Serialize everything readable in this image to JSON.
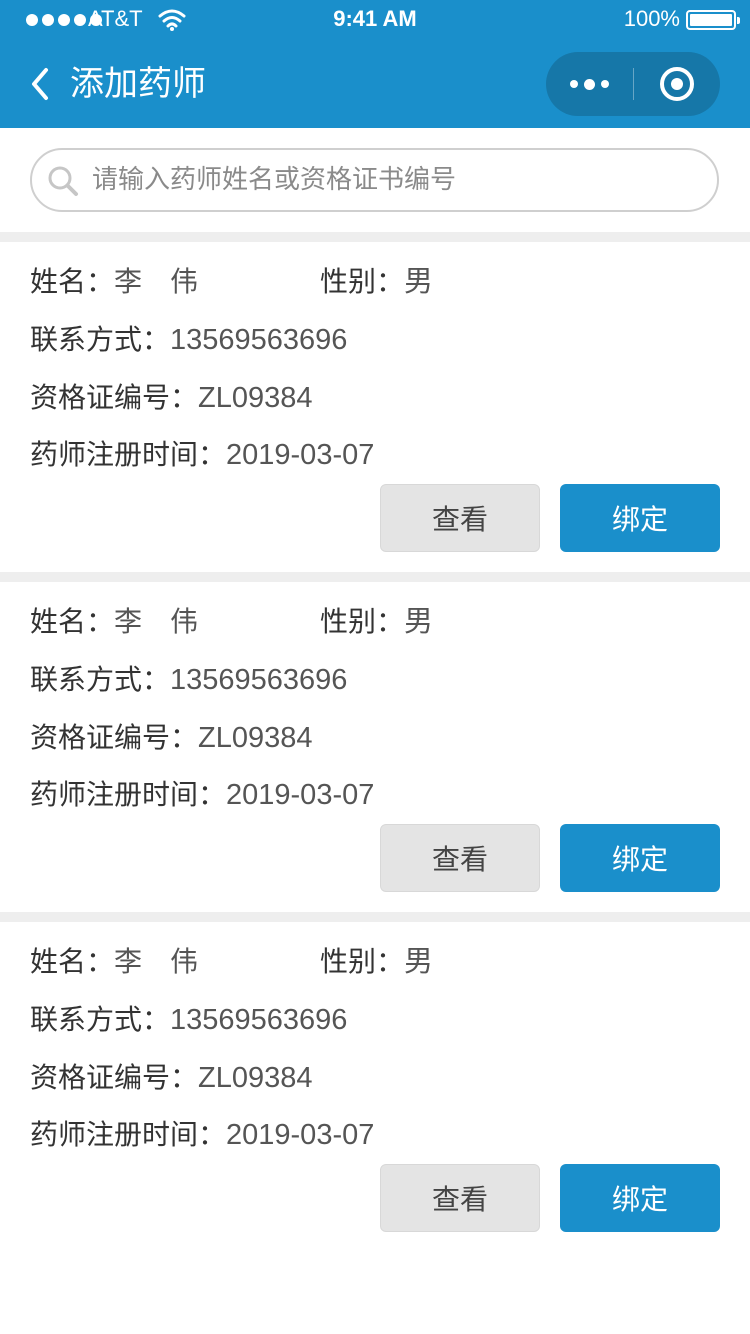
{
  "status_bar": {
    "carrier": "AT&T",
    "time": "9:41 AM",
    "battery": "100%"
  },
  "nav": {
    "title": "添加药师"
  },
  "search": {
    "placeholder": "请输入药师姓名或资格证书编号"
  },
  "labels": {
    "name": "姓名：",
    "gender": "性别：",
    "contact": "联系方式：",
    "cert_no": "资格证编号：",
    "reg_time": "药师注册时间：",
    "view_button": "查看",
    "bind_button": "绑定"
  },
  "pharmacists": [
    {
      "name": "李伟",
      "gender": "男",
      "contact": "13569563696",
      "cert_no": "ZL09384",
      "reg_time": "2019-03-07"
    },
    {
      "name": "李伟",
      "gender": "男",
      "contact": "13569563696",
      "cert_no": "ZL09384",
      "reg_time": "2019-03-07"
    },
    {
      "name": "李伟",
      "gender": "男",
      "contact": "13569563696",
      "cert_no": "ZL09384",
      "reg_time": "2019-03-07"
    }
  ],
  "colors": {
    "primary": "#1a8fcb",
    "capsule": "#1677a8",
    "secondary_button": "#e4e4e4",
    "separator": "#eeeeee"
  },
  "icons": {
    "back": "chevron-left-icon",
    "more": "more-dots-icon",
    "close": "target-circle-icon",
    "search": "search-icon",
    "wifi": "wifi-icon",
    "battery": "battery-icon"
  }
}
